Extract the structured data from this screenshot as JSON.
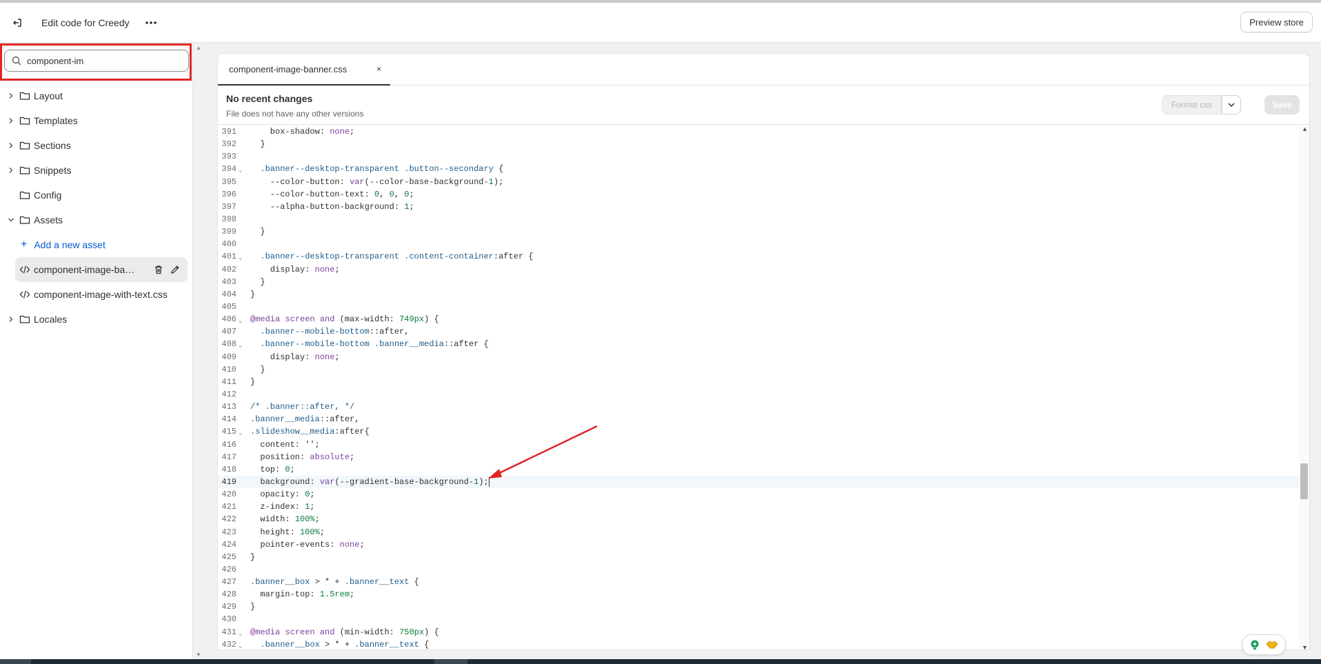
{
  "header": {
    "title": "Edit code for Creedy",
    "preview_label": "Preview store"
  },
  "search": {
    "value": "component-im"
  },
  "sidebar": {
    "folders_top": [
      {
        "label": "Layout"
      },
      {
        "label": "Templates"
      },
      {
        "label": "Sections"
      },
      {
        "label": "Snippets"
      },
      {
        "label": "Config"
      },
      {
        "label": "Assets"
      }
    ],
    "add_asset_label": "Add a new asset",
    "files": [
      {
        "label": "component-image-bann..."
      },
      {
        "label": "component-image-with-text.css"
      }
    ],
    "folders_bottom": [
      {
        "label": "Locales"
      }
    ]
  },
  "editor": {
    "tab_label": "component-image-banner.css",
    "tab_close": "×",
    "info_title": "No recent changes",
    "info_subtitle": "File does not have any other versions",
    "format_label": "Format css",
    "save_label": "Save",
    "current_line": 419,
    "lines": [
      {
        "n": "391",
        "text": "    box-shadow: none;"
      },
      {
        "n": "392",
        "text": "  }"
      },
      {
        "n": "393",
        "text": ""
      },
      {
        "n": "394",
        "fold": true,
        "text": "  .banner--desktop-transparent .button--secondary {"
      },
      {
        "n": "395",
        "text": "    --color-button: var(--color-base-background-1);"
      },
      {
        "n": "396",
        "text": "    --color-button-text: 0, 0, 0;"
      },
      {
        "n": "397",
        "text": "    --alpha-button-background: 1;"
      },
      {
        "n": "398",
        "text": ""
      },
      {
        "n": "399",
        "text": "  }"
      },
      {
        "n": "400",
        "text": ""
      },
      {
        "n": "401",
        "fold": true,
        "text": "  .banner--desktop-transparent .content-container:after {"
      },
      {
        "n": "402",
        "text": "    display: none;"
      },
      {
        "n": "403",
        "text": "  }"
      },
      {
        "n": "404",
        "text": "}"
      },
      {
        "n": "405",
        "text": ""
      },
      {
        "n": "406",
        "fold": true,
        "text": "@media screen and (max-width: 749px) {"
      },
      {
        "n": "407",
        "text": "  .banner--mobile-bottom::after,"
      },
      {
        "n": "408",
        "fold": true,
        "text": "  .banner--mobile-bottom .banner__media::after {"
      },
      {
        "n": "409",
        "text": "    display: none;"
      },
      {
        "n": "410",
        "text": "  }"
      },
      {
        "n": "411",
        "text": "}"
      },
      {
        "n": "412",
        "text": ""
      },
      {
        "n": "413",
        "text": "/* .banner::after, */"
      },
      {
        "n": "414",
        "text": ".banner__media::after,"
      },
      {
        "n": "415",
        "fold": true,
        "text": ".slideshow__media:after{"
      },
      {
        "n": "416",
        "text": "  content: '';"
      },
      {
        "n": "417",
        "text": "  position: absolute;"
      },
      {
        "n": "418",
        "text": "  top: 0;"
      },
      {
        "n": "419",
        "text": "  background: var(--gradient-base-background-1);"
      },
      {
        "n": "420",
        "text": "  opacity: 0;"
      },
      {
        "n": "421",
        "text": "  z-index: 1;"
      },
      {
        "n": "422",
        "text": "  width: 100%;"
      },
      {
        "n": "423",
        "text": "  height: 100%;"
      },
      {
        "n": "424",
        "text": "  pointer-events: none;"
      },
      {
        "n": "425",
        "text": "}"
      },
      {
        "n": "426",
        "text": ""
      },
      {
        "n": "427",
        "text": ".banner__box > * + .banner__text {"
      },
      {
        "n": "428",
        "text": "  margin-top: 1.5rem;"
      },
      {
        "n": "429",
        "text": "}"
      },
      {
        "n": "430",
        "text": ""
      },
      {
        "n": "431",
        "fold": true,
        "text": "@media screen and (min-width: 750px) {"
      },
      {
        "n": "432",
        "fold": true,
        "text": "  .banner__box > * + .banner__text {"
      }
    ]
  },
  "colors": {
    "accent_link": "#005bd3",
    "annotation_red": "#e02424",
    "selector": "#1f5c8a",
    "keyword": "#7a3e9d",
    "number": "#0a7a3a",
    "comment": "#1f5c8a"
  }
}
